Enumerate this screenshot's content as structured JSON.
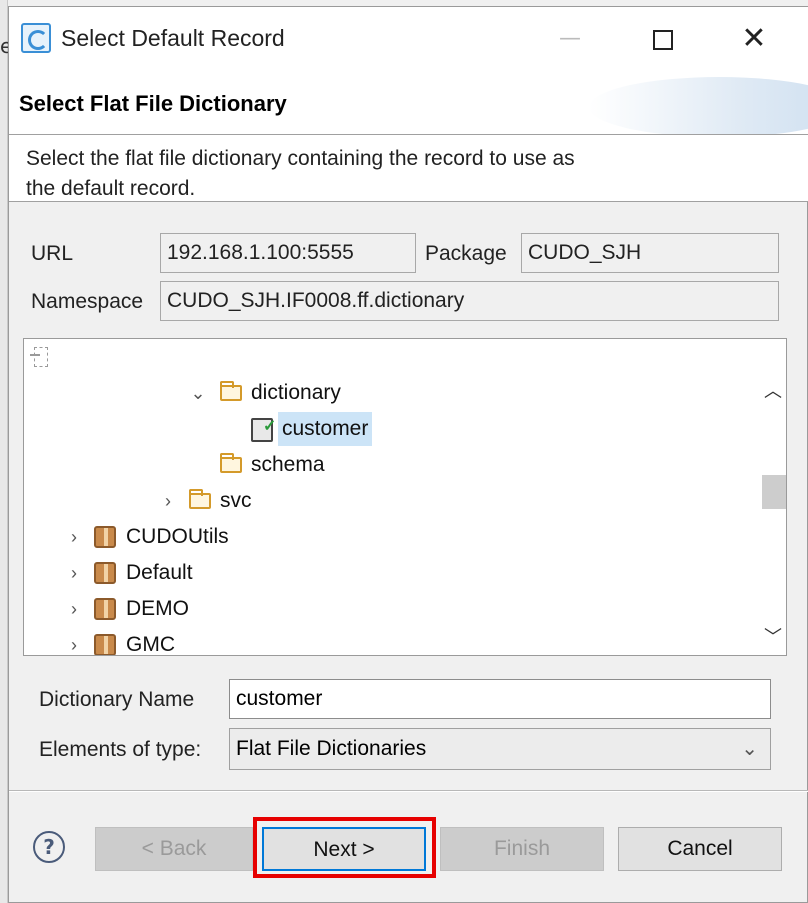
{
  "window": {
    "title": "Select Default Record",
    "close_glyph": "✕",
    "minimize_glyph": "—"
  },
  "banner": {
    "title": "Select Flat File Dictionary",
    "description": "Select the flat file dictionary containing the record to use as the default record."
  },
  "info": {
    "url_label": "URL",
    "url_value": "192.168.1.100:5555",
    "package_label": "Package",
    "package_value": "CUDO_SJH",
    "namespace_label": "Namespace",
    "namespace_value": "CUDO_SJH.IF0008.ff.dictionary"
  },
  "tree": {
    "items": [
      {
        "label": "dictionary",
        "icon": "folder-open-icon",
        "expanded": true
      },
      {
        "label": "customer",
        "icon": "flat-file-dictionary-icon",
        "selected": true
      },
      {
        "label": "schema",
        "icon": "folder-open-icon"
      },
      {
        "label": "svc",
        "icon": "folder-open-icon",
        "expanded": false
      },
      {
        "label": "CUDOUtils",
        "icon": "package-icon",
        "expanded": false
      },
      {
        "label": "Default",
        "icon": "package-icon",
        "expanded": false
      },
      {
        "label": "DEMO",
        "icon": "package-icon",
        "expanded": false
      },
      {
        "label": "GMC",
        "icon": "package-icon",
        "expanded": false
      }
    ]
  },
  "form": {
    "dictionary_name_label": "Dictionary Name",
    "dictionary_name_value": "customer",
    "elements_of_type_label": "Elements of type:",
    "elements_of_type_value": "Flat File Dictionaries"
  },
  "buttons": {
    "help": "?",
    "back": "< Back",
    "next": "Next >",
    "finish": "Finish",
    "cancel": "Cancel"
  },
  "colors": {
    "highlight": "#e60000",
    "selection": "#cce4f7",
    "default_button_border": "#0078d7"
  }
}
